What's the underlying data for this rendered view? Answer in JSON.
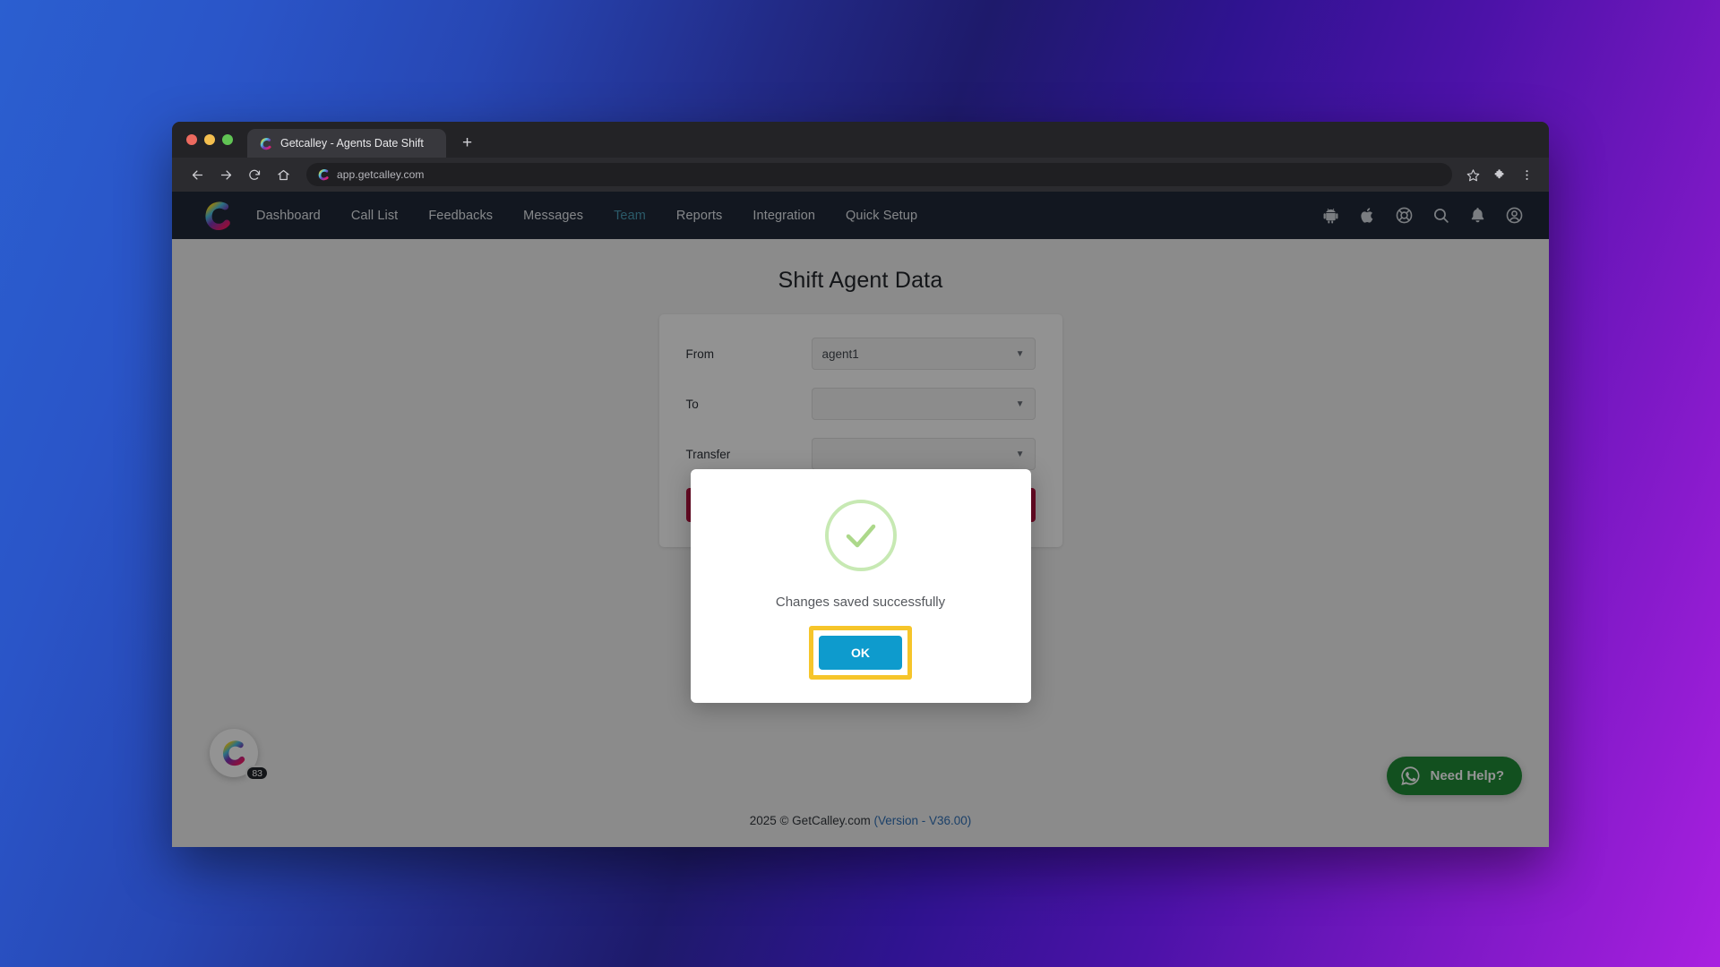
{
  "browser": {
    "tab": {
      "title": "Getcalley - Agents Date Shift",
      "favicon": "calley-logo-icon"
    },
    "new_tab_label": "+",
    "controls": {
      "back": "back-arrow-icon",
      "forward": "forward-arrow-icon",
      "reload": "reload-icon",
      "home": "home-icon"
    },
    "omnibox": {
      "url": "app.getcalley.com",
      "site_icon": "calley-logo-icon"
    },
    "toolbar_icons": {
      "bookmark": "star-icon",
      "extensions": "puzzle-piece-icon",
      "menu": "three-dot-menu-icon"
    },
    "traffic_lights": {
      "close": "#ed6a5f",
      "minimize": "#f4bf4f",
      "maximize": "#61c454"
    }
  },
  "appnav": {
    "brand": "calley-logo-icon",
    "links": [
      {
        "label": "Dashboard",
        "active": false
      },
      {
        "label": "Call List",
        "active": false
      },
      {
        "label": "Feedbacks",
        "active": false
      },
      {
        "label": "Messages",
        "active": false
      },
      {
        "label": "Team",
        "active": true
      },
      {
        "label": "Reports",
        "active": false
      },
      {
        "label": "Integration",
        "active": false
      },
      {
        "label": "Quick Setup",
        "active": false
      }
    ],
    "icons": [
      "android-icon",
      "apple-icon",
      "lifebuoy-support-icon",
      "search-icon",
      "bell-notification-icon",
      "user-account-icon"
    ],
    "background_color": "#1f2937",
    "active_link_color": "#4a9cb5"
  },
  "page": {
    "title": "Shift Agent Data",
    "form": {
      "rows": [
        {
          "label": "From",
          "value": "agent1",
          "type": "select"
        },
        {
          "label": "To",
          "value": "",
          "type": "select"
        },
        {
          "label": "Transfer",
          "value": "",
          "type": "select"
        }
      ],
      "submit_label": "",
      "submit_color": "#b3123f"
    },
    "footer": {
      "copyright": "2025 © GetCalley.com",
      "version": "(Version - V36.00)",
      "version_color": "#2f6fb5"
    },
    "widgets": {
      "calley_badge": {
        "icon": "calley-logo-icon",
        "count": "83"
      },
      "need_help": {
        "label": "Need Help?",
        "icon": "whatsapp-icon",
        "color": "#1f8a36"
      }
    }
  },
  "modal": {
    "icon": "success-check-icon",
    "icon_color": "#7ac143",
    "message": "Changes saved successfully",
    "ok_label": "OK",
    "ok_color": "#0e9bcd",
    "highlight_color": "#f6c52a"
  }
}
